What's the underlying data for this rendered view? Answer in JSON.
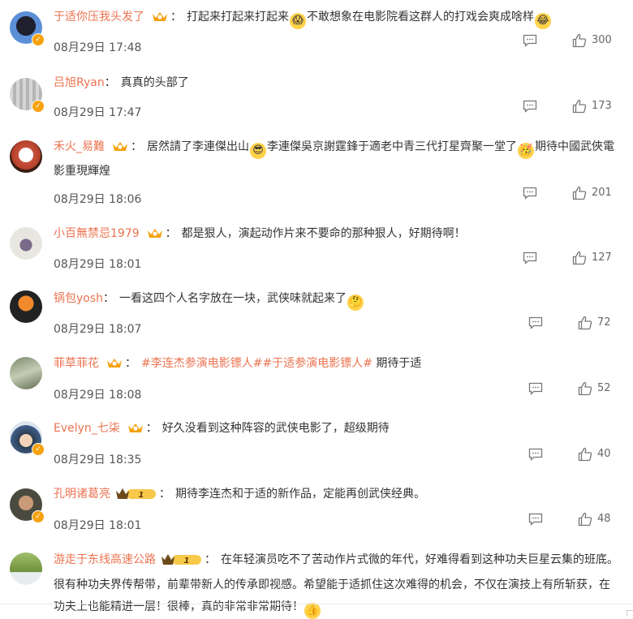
{
  "comments": [
    {
      "user": "于适你压我头发了",
      "badge": "crown",
      "segments": [
        {
          "t": "："
        },
        {
          "t": "打起来打起来打起来"
        },
        {
          "e": "😱"
        },
        {
          "t": "不敢想象在电影院看这群人的打戏会爽成啥样"
        },
        {
          "e": "😂"
        }
      ],
      "time": "08月29日 17:48",
      "likes": "300"
    },
    {
      "user": "吕旭Ryan",
      "badge": "",
      "segments": [
        {
          "t": "："
        },
        {
          "t": "真真的头部了"
        }
      ],
      "time": "08月29日 17:47",
      "likes": "173"
    },
    {
      "user": "禾火_易難",
      "badge": "crown",
      "segments": [
        {
          "t": "："
        },
        {
          "t": "居然請了李連傑出山"
        },
        {
          "e": "😎"
        },
        {
          "t": "李連傑吳京謝霆鋒于適老中青三代打星齊聚一堂了"
        },
        {
          "e": "🥳"
        },
        {
          "t": "期待中國武俠電影重現輝煌"
        }
      ],
      "time": "08月29日 18:06",
      "likes": "201"
    },
    {
      "user": "小百無禁忌1979",
      "badge": "crown",
      "segments": [
        {
          "t": "："
        },
        {
          "t": "都是狠人，演起动作片来不要命的那种狠人，好期待啊！"
        }
      ],
      "time": "08月29日 18:01",
      "likes": "127"
    },
    {
      "user": "锅包yosh",
      "badge": "",
      "segments": [
        {
          "t": "："
        },
        {
          "t": "一看这四个人名字放在一块，武侠味就起来了"
        },
        {
          "e": "🤔"
        }
      ],
      "time": "08月29日 18:07",
      "likes": "72"
    },
    {
      "user": "菲草菲花",
      "badge": "crown",
      "segments": [
        {
          "t": "："
        },
        {
          "topic": "#李连杰参演电影镖人#"
        },
        {
          "topic": "#于适参演电影镖人#"
        },
        {
          "t": " 期待于适"
        }
      ],
      "time": "08月29日 18:08",
      "likes": "52"
    },
    {
      "user": "Evelyn_七柒",
      "badge": "crown",
      "segments": [
        {
          "t": "："
        },
        {
          "t": "好久没看到这种阵容的武侠电影了，超级期待"
        }
      ],
      "time": "08月29日 18:35",
      "likes": "40"
    },
    {
      "user": "孔明诸葛亮",
      "badge": "level",
      "level": "1",
      "segments": [
        {
          "t": "："
        },
        {
          "t": "期待李连杰和于适的新作品，定能再创武侠经典。"
        }
      ],
      "time": "08月29日 18:01",
      "likes": "48"
    },
    {
      "user": "游走于东线高速公路",
      "badge": "level",
      "level": "1",
      "segments": [
        {
          "t": "："
        },
        {
          "t": "在年轻演员吃不了苦动作片式微的年代，好难得看到这种功夫巨星云集的班底。很有种功夫界传帮带，前辈带新人的传承即视感。希望能于适抓住这次难得的机会，不仅在演技上有所斩获，在功夫上也能精进一层！很棒，真的非常非常期待！"
        },
        {
          "e": "👍"
        }
      ],
      "time": "",
      "likes": ""
    }
  ],
  "colors": {
    "username": "#eb7350",
    "badge": "#f6a10e"
  }
}
